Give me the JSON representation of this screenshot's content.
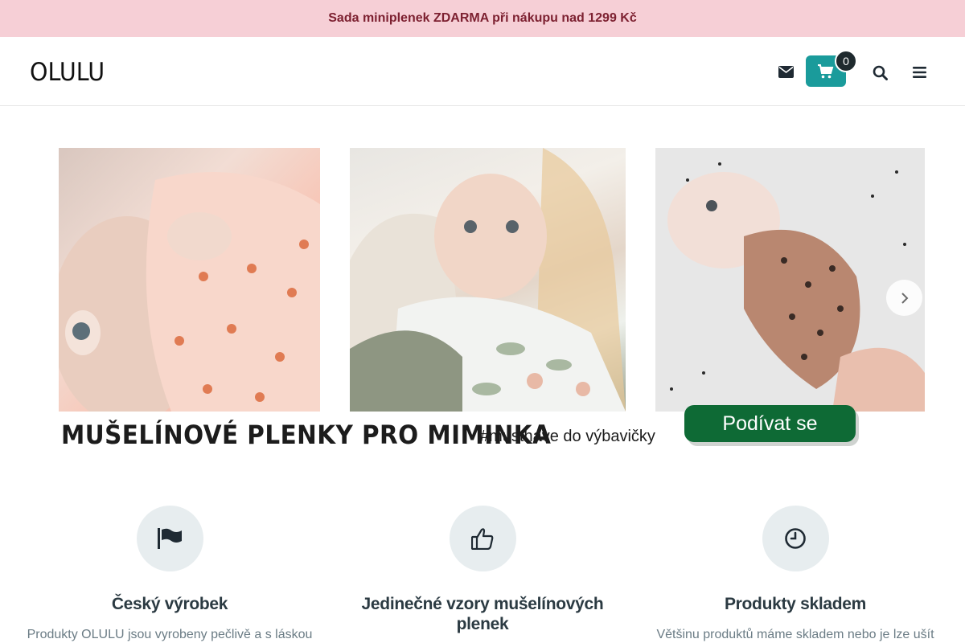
{
  "promo": {
    "text": "Sada miniplenek ZDARMA při nákupu nad 1299 Kč"
  },
  "header": {
    "logo": "OLULU",
    "cart_count": "0",
    "icons": [
      "envelope-icon",
      "cart-icon",
      "search-icon",
      "hamburger-menu-icon"
    ]
  },
  "banner": {
    "headline": "MUŠELÍNOVÉ PLENKY PRO MIMINKA",
    "hashtag": "#musthave do výbavičky",
    "cta": "Podívat se",
    "cta_color": "#0e6a35"
  },
  "features": [
    {
      "icon": "flag-icon",
      "title": "Český výrobek",
      "text": "Produkty OLULU jsou vyrobeny pečlivě a s láskou"
    },
    {
      "icon": "thumbs-up-icon",
      "title": "Jedinečné vzory mušelínových plenek",
      "text": ""
    },
    {
      "icon": "clock-icon",
      "title": "Produkty skladem",
      "text": "Většinu produktů máme skladem nebo je lze ušít"
    }
  ],
  "colors": {
    "promo_bg": "#f6cfd6",
    "promo_text": "#7d2131",
    "accent": "#1a9b9b"
  }
}
